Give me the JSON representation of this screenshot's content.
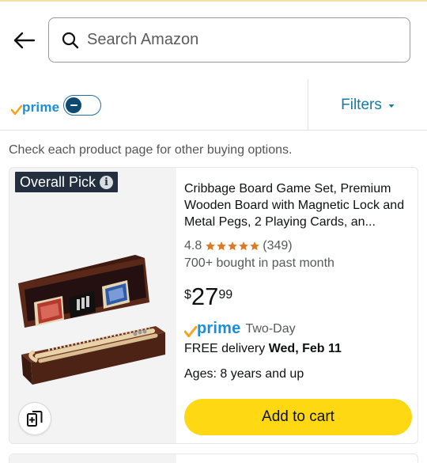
{
  "header": {
    "back_icon": "arrow-left-icon",
    "search": {
      "placeholder": "Search Amazon",
      "value": "",
      "icon": "search-icon"
    }
  },
  "filter_bar": {
    "prime_label": "prime",
    "prime_toggle_on": false,
    "filters_label": "Filters"
  },
  "notice": "Check each product page for other buying options.",
  "product": {
    "badge": "Overall Pick",
    "badge_info_glyph": "i",
    "image_icon": "cribbage-board-image",
    "compare_icon": "card-compare-icon",
    "title": "Cribbage Board Game Set, Premium Wooden Board with Magnetic Lock and Metal Pegs, 2 Playing Cards, an...",
    "rating": "4.8",
    "rating_stars": 4.8,
    "review_count": "(349)",
    "bought": "700+ bought in past month",
    "price": {
      "symbol": "$",
      "whole": "27",
      "fraction": "99"
    },
    "prime_label": "prime",
    "prime_speed": "Two-Day",
    "delivery_prefix": "FREE delivery ",
    "delivery_date": "Wed, Feb 11",
    "ages": "Ages: 8 years and up",
    "add_to_cart": "Add to cart"
  },
  "colors": {
    "accent_blue": "#147ba5",
    "prime_blue": "#1a8fd8",
    "prime_orange": "#f7a41d",
    "star_orange": "#de7921",
    "cart_yellow": "#ffd814",
    "badge_dark": "#232f3e"
  }
}
